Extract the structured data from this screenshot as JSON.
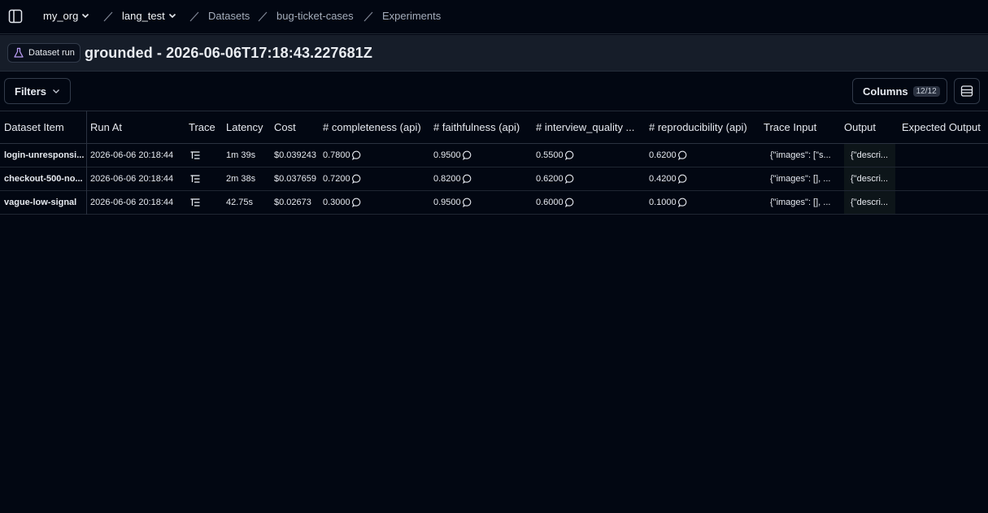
{
  "nav": {
    "org": "my_org",
    "project": "lang_test",
    "datasets": "Datasets",
    "dataset": "bug-ticket-cases",
    "experiments": "Experiments"
  },
  "header": {
    "badge_label": "Dataset run",
    "title": "grounded - 2026-06-06T17:18:43.227681Z"
  },
  "toolbar": {
    "filters_label": "Filters",
    "columns_label": "Columns",
    "columns_count": "12/12"
  },
  "table": {
    "columns": [
      "Dataset Item",
      "Run At",
      "Trace",
      "Latency",
      "Cost",
      "# completeness (api)",
      "# faithfulness (api)",
      "# interview_quality ...",
      "# reproducibility (api)",
      "Trace Input",
      "Output",
      "Expected Output"
    ],
    "rows": [
      {
        "item": "login-unresponsi...",
        "run_at": "2026-06-06 20:18:44",
        "latency": "1m 39s",
        "cost": "$0.039243",
        "completeness": "0.7800",
        "faithfulness": "0.9500",
        "interview_quality": "0.5500",
        "reproducibility": "0.6200",
        "trace_input": "{\"images\": [\"s...",
        "output": "{\"descri...",
        "expected_output": ""
      },
      {
        "item": "checkout-500-no...",
        "run_at": "2026-06-06 20:18:44",
        "latency": "2m 38s",
        "cost": "$0.037659",
        "completeness": "0.7200",
        "faithfulness": "0.8200",
        "interview_quality": "0.6200",
        "reproducibility": "0.4200",
        "trace_input": "{\"images\": [], ...",
        "output": "{\"descri...",
        "expected_output": ""
      },
      {
        "item": "vague-low-signal",
        "run_at": "2026-06-06 20:18:44",
        "latency": "42.75s",
        "cost": "$0.02673",
        "completeness": "0.3000",
        "faithfulness": "0.9500",
        "interview_quality": "0.6000",
        "reproducibility": "0.1000",
        "trace_input": "{\"images\": [], ...",
        "output": "{\"descri...",
        "expected_output": ""
      }
    ]
  }
}
